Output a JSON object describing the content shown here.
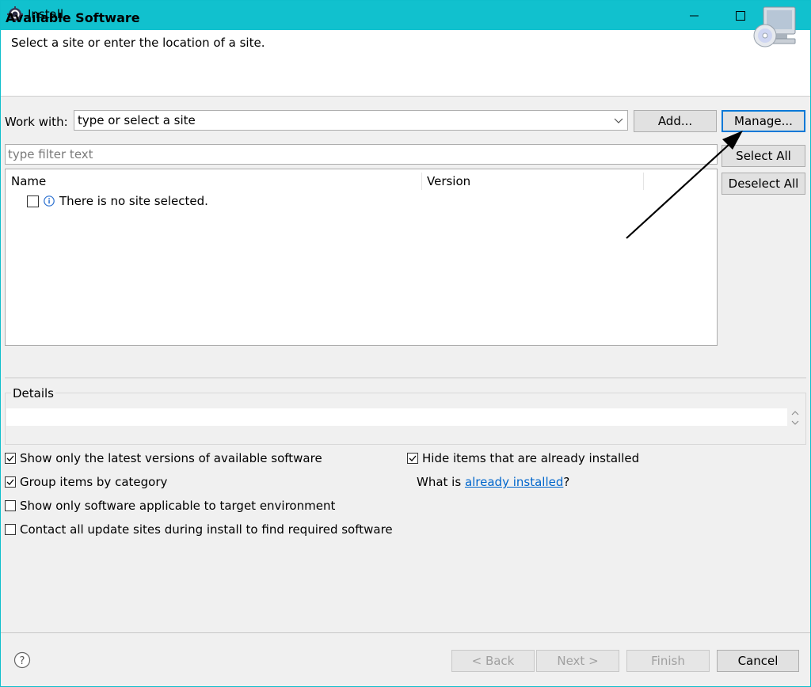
{
  "window": {
    "title": "Install"
  },
  "header": {
    "title": "Available Software",
    "subtitle": "Select a site or enter the location of a site."
  },
  "work_with": {
    "label": "Work with:",
    "value": "type or select a site",
    "add_label": "Add...",
    "manage_label": "Manage..."
  },
  "filter": {
    "placeholder": "type filter text"
  },
  "table": {
    "columns": [
      "Name",
      "Version"
    ],
    "rows": [
      {
        "text": "There is no site selected."
      }
    ]
  },
  "side_buttons": {
    "select_all": "Select All",
    "deselect_all": "Deselect All"
  },
  "details": {
    "label": "Details"
  },
  "options": {
    "latest_versions": {
      "label": "Show only the latest versions of available software",
      "checked": true
    },
    "group_by_category": {
      "label": "Group items by category",
      "checked": true
    },
    "target_env": {
      "label": "Show only software applicable to target environment",
      "checked": false
    },
    "contact_all": {
      "label": "Contact all update sites during install to find required software",
      "checked": false
    },
    "hide_installed": {
      "label": "Hide items that are already installed",
      "checked": true
    },
    "what_is_prefix": "What is ",
    "what_is_link": "already installed",
    "what_is_suffix": "?"
  },
  "footer": {
    "back": "< Back",
    "next": "Next >",
    "finish": "Finish",
    "cancel": "Cancel"
  },
  "colors": {
    "titlebar": "#11c1ce",
    "accent": "#0078d7",
    "link": "#0066cc"
  }
}
